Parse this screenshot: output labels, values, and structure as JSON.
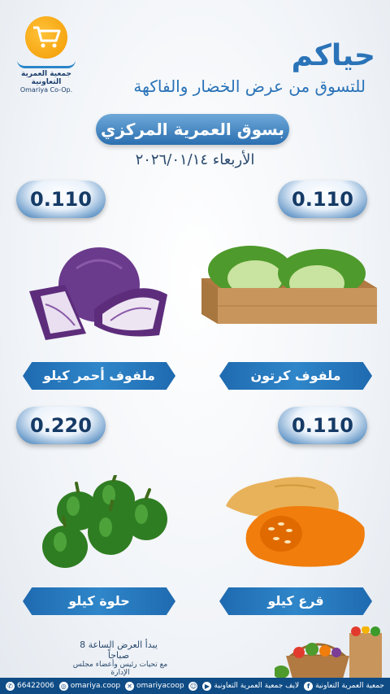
{
  "logo": {
    "name_ar": "جمعية العمرية التعاونية",
    "name_en": "Omariya Co-Op."
  },
  "header": {
    "title": "حياكم",
    "subtitle": "للتسوق من عرض الخضار والفاكهة",
    "market": "بسوق العمرية المركزي",
    "date": "الأربعاء ٢٠٢٦/٠١/١٤"
  },
  "products": [
    {
      "name": "ملفوف كرتون",
      "price": "0.110",
      "icon": "cabbage-box"
    },
    {
      "name": "ملفوف أحمر كيلو",
      "price": "0.110",
      "icon": "red-cabbage"
    },
    {
      "name": "قرع كيلو",
      "price": "0.110",
      "icon": "butternut-squash"
    },
    {
      "name": "حلوة كيلو",
      "price": "0.220",
      "icon": "green-peppers"
    }
  ],
  "notes": {
    "start_time": "يبدأ العرض الساعة 8 صباحاً",
    "greeting": "مع تحيات رئيس وأعضاء مجلس الإدارة"
  },
  "footer": {
    "phone": "66422006",
    "instagram": "omariya.coop",
    "x": "omariyacoop",
    "snapchat": "omariyacoop",
    "live": "لايف جمعية العمرية التعاونية",
    "facebook": "جمعية العمرية التعاونية"
  },
  "colors": {
    "primary": "#2a73b8",
    "accent": "#f29a00",
    "footer": "#0f4c86"
  }
}
